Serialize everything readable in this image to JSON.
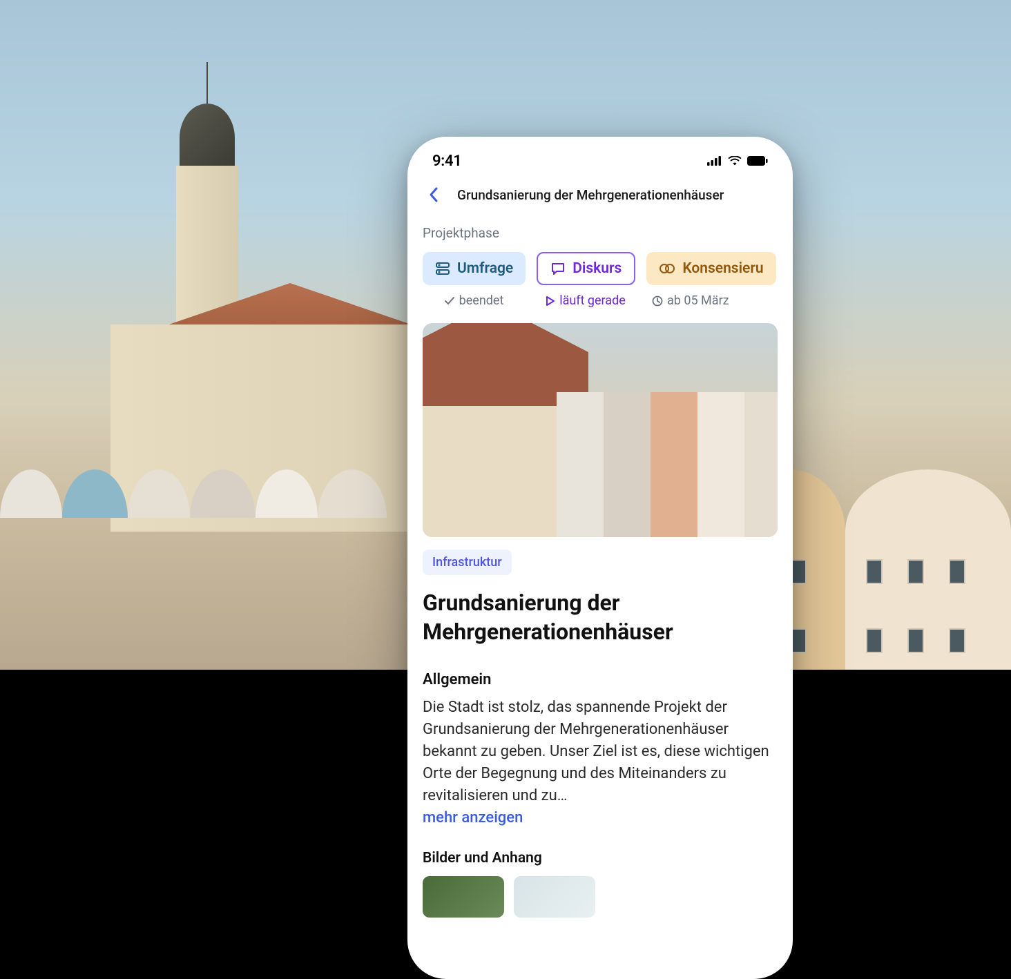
{
  "status_bar": {
    "time": "9:41"
  },
  "nav": {
    "title": "Grundsanierung der Mehrgenerationenhäuser"
  },
  "phase": {
    "label": "Projektphase",
    "umfrage": "Umfrage",
    "diskurs": "Diskurs",
    "konsens": "Konsensieru",
    "status_beendet": "beendet",
    "status_lauft": "läuft gerade",
    "status_ab": "ab 05 März"
  },
  "main": {
    "tag": "Infrastruktur",
    "title": "Grundsanierung der Mehrgenerationenhäuser",
    "section_general": "Allgemein",
    "body": "Die Stadt ist stolz, das spannende Projekt der Grundsanierung der Mehrgenerationen­häuser bekannt zu geben. Unser Ziel ist es, diese wichtigen Orte der Begegnung und des Miteinanders zu revitalisieren und zu…",
    "more": "mehr anzeigen",
    "attachments_title": "Bilder und Anhang"
  }
}
